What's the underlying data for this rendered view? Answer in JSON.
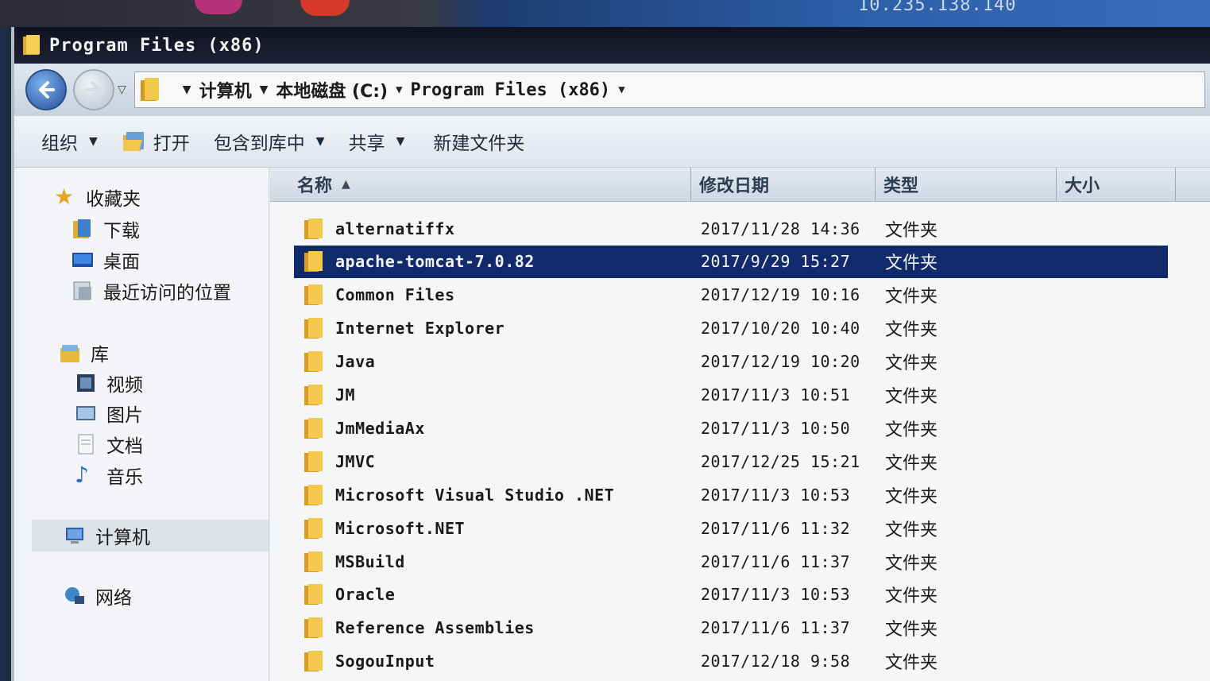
{
  "remote": {
    "ip": "10.235.138.140"
  },
  "window": {
    "title": "Program Files (x86)"
  },
  "address": {
    "crumbs": [
      "计算机",
      "本地磁盘 (C:)",
      "Program Files (x86)"
    ]
  },
  "toolbar": {
    "organize": "组织",
    "open": "打开",
    "include_in_library": "包含到库中",
    "share": "共享",
    "new_folder": "新建文件夹"
  },
  "nav": {
    "favorites": "收藏夹",
    "downloads": "下载",
    "desktop": "桌面",
    "recent": "最近访问的位置",
    "libraries": "库",
    "videos": "视频",
    "pictures": "图片",
    "documents": "文档",
    "music": "音乐",
    "computer": "计算机",
    "network": "网络"
  },
  "columns": {
    "name": "名称",
    "modified": "修改日期",
    "type": "类型",
    "size": "大小"
  },
  "files": [
    {
      "name": "alternatiffx",
      "date": "2017/11/28 14:36",
      "type": "文件夹"
    },
    {
      "name": "apache-tomcat-7.0.82",
      "date": "2017/9/29 15:27",
      "type": "文件夹",
      "selected": true
    },
    {
      "name": "Common Files",
      "date": "2017/12/19 10:16",
      "type": "文件夹"
    },
    {
      "name": "Internet Explorer",
      "date": "2017/10/20 10:40",
      "type": "文件夹"
    },
    {
      "name": "Java",
      "date": "2017/12/19 10:20",
      "type": "文件夹"
    },
    {
      "name": "JM",
      "date": "2017/11/3 10:51",
      "type": "文件夹"
    },
    {
      "name": "JmMediaAx",
      "date": "2017/11/3 10:50",
      "type": "文件夹"
    },
    {
      "name": "JMVC",
      "date": "2017/12/25 15:21",
      "type": "文件夹"
    },
    {
      "name": "Microsoft Visual Studio .NET",
      "date": "2017/11/3 10:53",
      "type": "文件夹"
    },
    {
      "name": "Microsoft.NET",
      "date": "2017/11/6 11:32",
      "type": "文件夹"
    },
    {
      "name": "MSBuild",
      "date": "2017/11/6 11:37",
      "type": "文件夹"
    },
    {
      "name": "Oracle",
      "date": "2017/11/3 10:53",
      "type": "文件夹"
    },
    {
      "name": "Reference Assemblies",
      "date": "2017/11/6 11:37",
      "type": "文件夹"
    },
    {
      "name": "SogouInput",
      "date": "2017/12/18 9:58",
      "type": "文件夹"
    }
  ]
}
